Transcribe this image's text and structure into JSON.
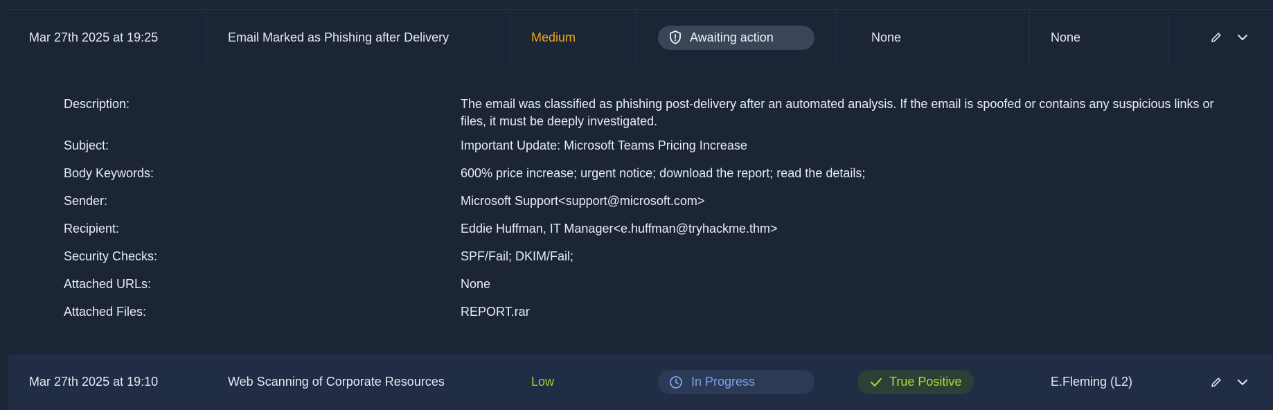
{
  "alerts": [
    {
      "datetime": "Mar 27th 2025 at 19:25",
      "title": "Email Marked as Phishing after Delivery",
      "severity": "Medium",
      "status": "Awaiting action",
      "verdict": "None",
      "assignee": "None",
      "status_icon": "shield-icon"
    },
    {
      "datetime": "Mar 27th 2025 at 19:10",
      "title": "Web Scanning of Corporate Resources",
      "severity": "Low",
      "status": "In Progress",
      "verdict": "True Positive",
      "assignee": "E.Fleming (L2)",
      "status_icon": "clock-icon",
      "verdict_icon": "check-icon"
    }
  ],
  "details": {
    "description_label": "Description:",
    "description": "The email was classified as phishing post-delivery after an automated analysis. If the email is spoofed or contains any suspicious links or files, it must be deeply investigated.",
    "subject_label": "Subject:",
    "subject": "Important Update: Microsoft Teams Pricing Increase",
    "keywords_label": "Body Keywords:",
    "keywords": "600% price increase; urgent notice; download the report; read the details;",
    "sender_label": "Sender:",
    "sender": "Microsoft Support<support@microsoft.com>",
    "recipient_label": "Recipient:",
    "recipient": "Eddie Huffman, IT Manager<e.huffman@tryhackme.thm>",
    "checks_label": "Security Checks:",
    "checks": "SPF/Fail; DKIM/Fail;",
    "urls_label": "Attached URLs:",
    "urls": "None",
    "files_label": "Attached Files:",
    "files": "REPORT.rar"
  },
  "colors": {
    "background": "#1c2535",
    "severity_medium": "#f0a81e",
    "severity_low": "#9fd62d",
    "status_in_progress": "#7da2f0",
    "verdict_true_positive": "#a8e03a"
  }
}
